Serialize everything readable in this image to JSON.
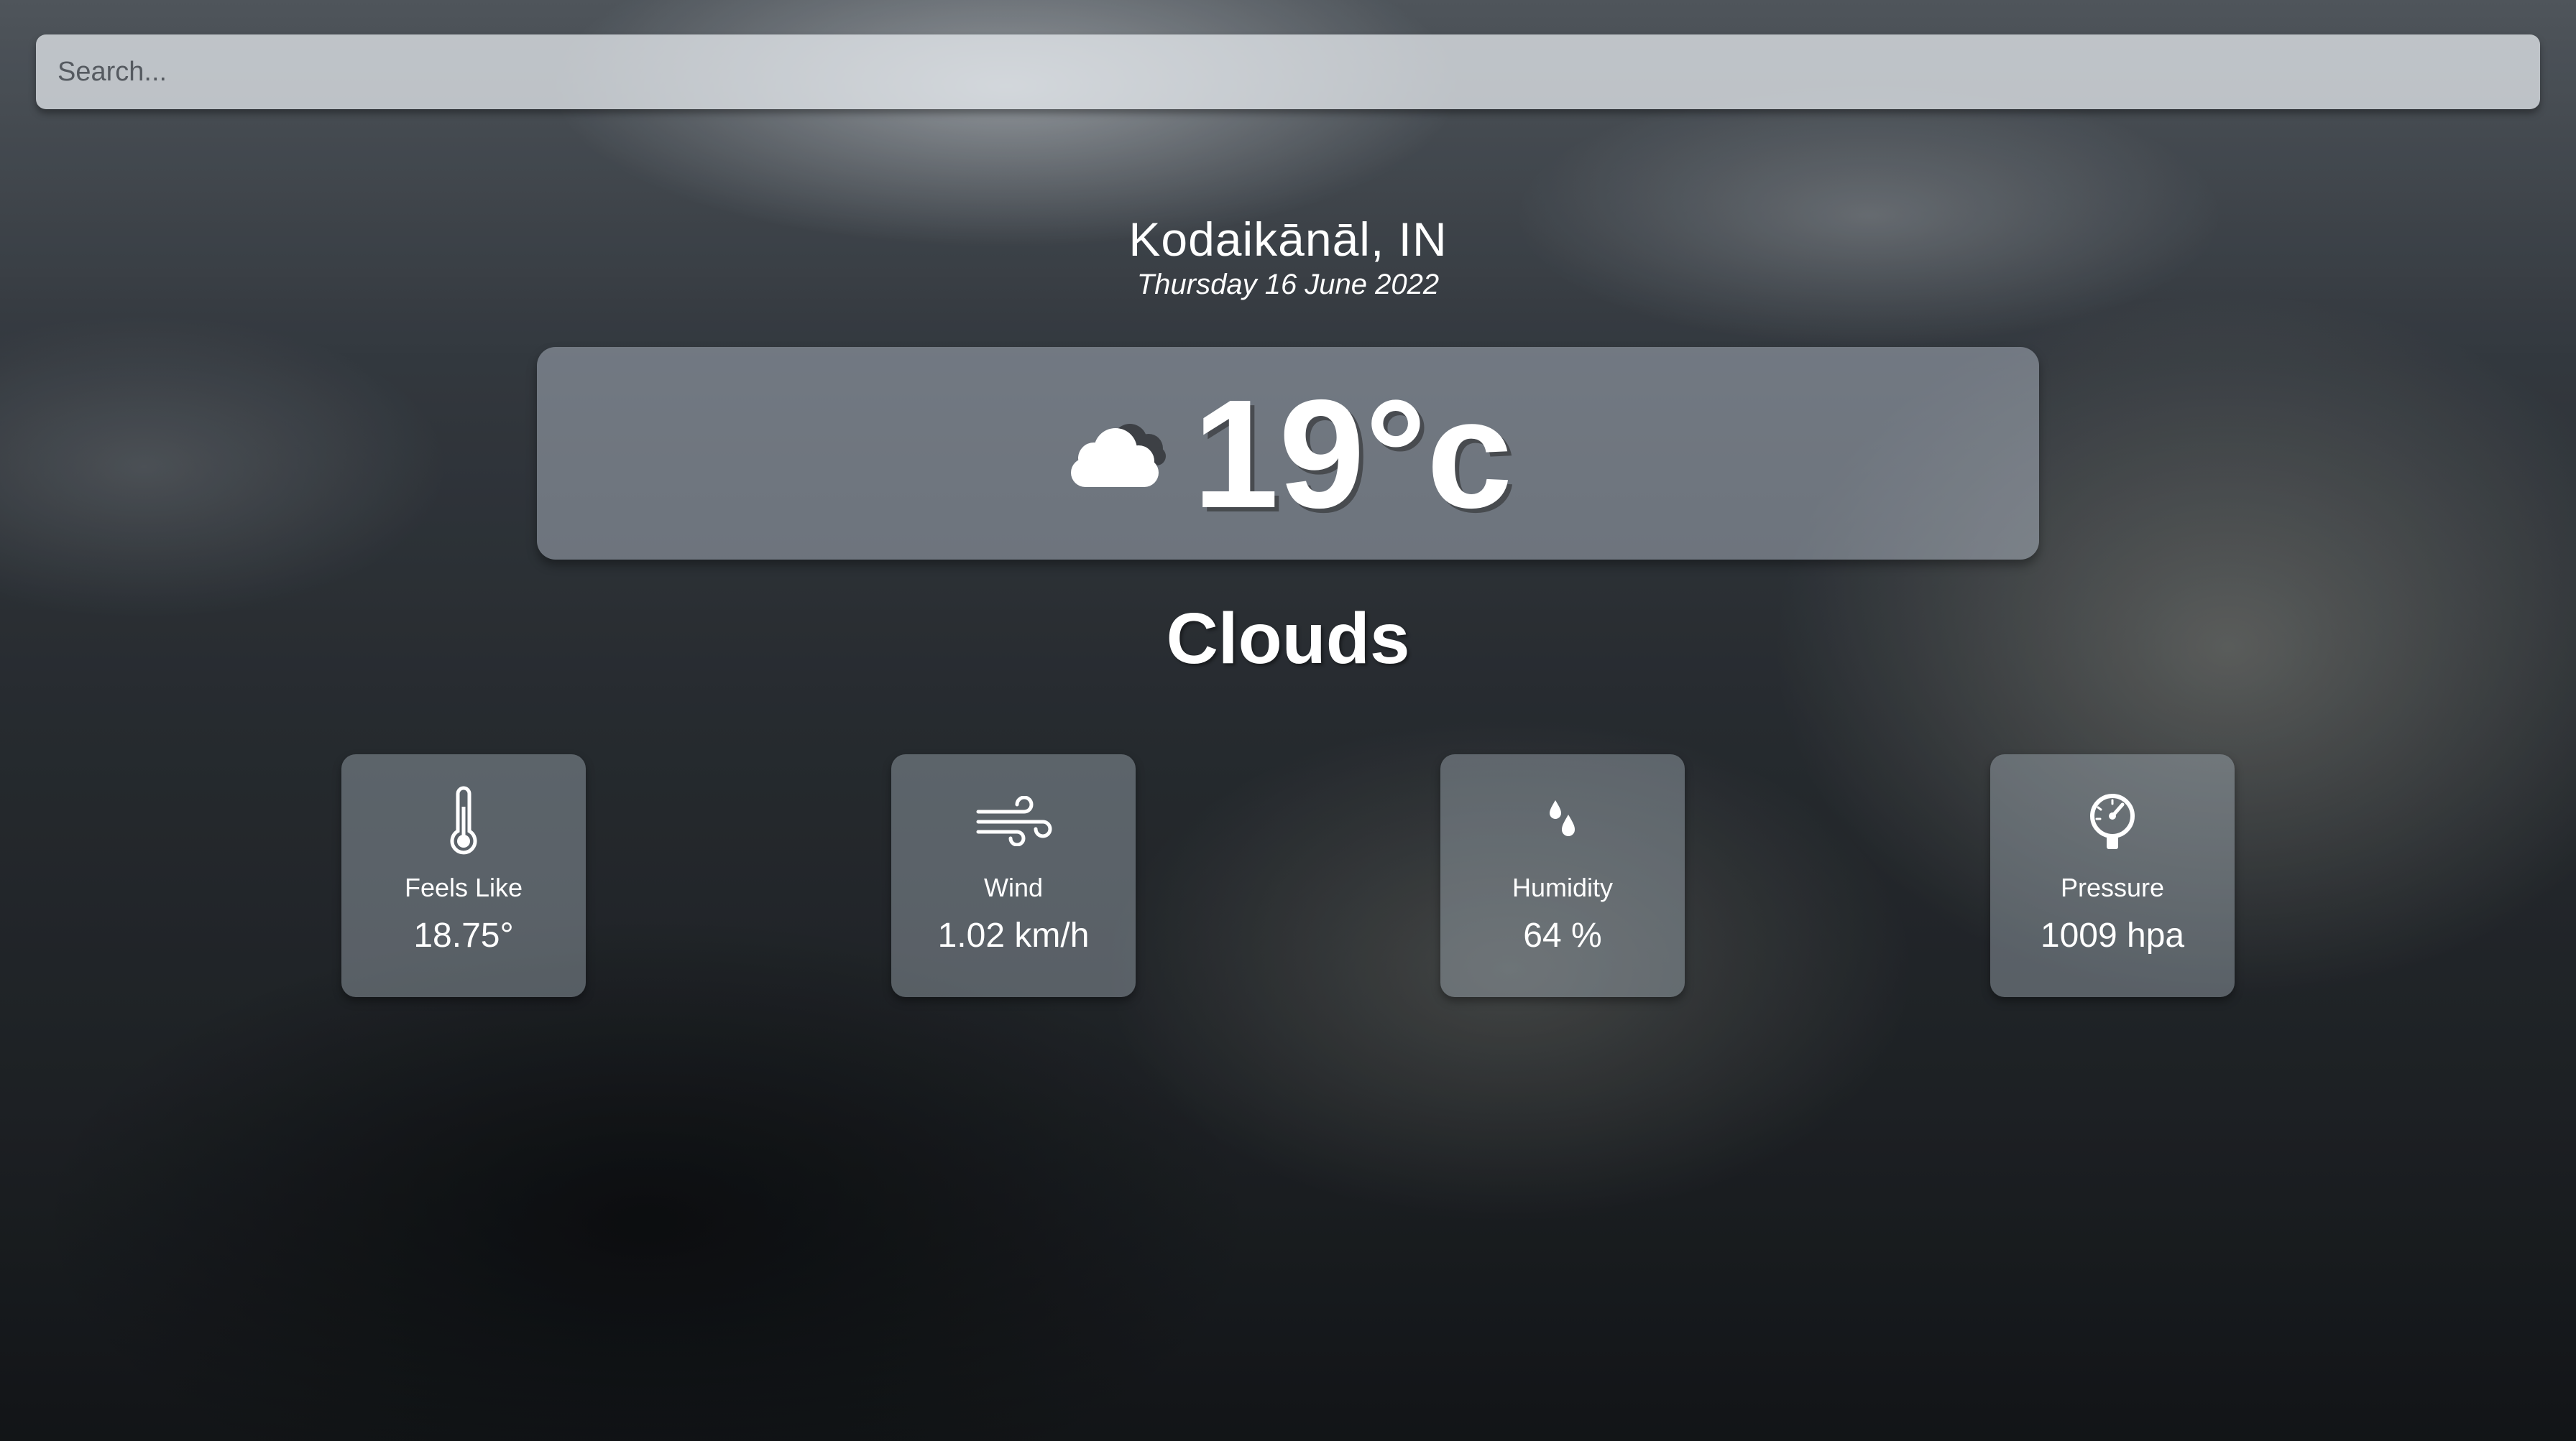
{
  "search": {
    "placeholder": "Search...",
    "value": ""
  },
  "location": {
    "city": "Kodaikānāl, IN",
    "date": "Thursday 16 June 2022"
  },
  "current": {
    "icon": "cloud-icon",
    "temperature": "19°c",
    "condition": "Clouds"
  },
  "stats": [
    {
      "icon": "thermometer-icon",
      "label": "Feels Like",
      "value": "18.75°"
    },
    {
      "icon": "wind-icon",
      "label": "Wind",
      "value": "1.02 km/h"
    },
    {
      "icon": "humidity-icon",
      "label": "Humidity",
      "value": "64 %"
    },
    {
      "icon": "pressure-gauge-icon",
      "label": "Pressure",
      "value": "1009 hpa"
    }
  ]
}
